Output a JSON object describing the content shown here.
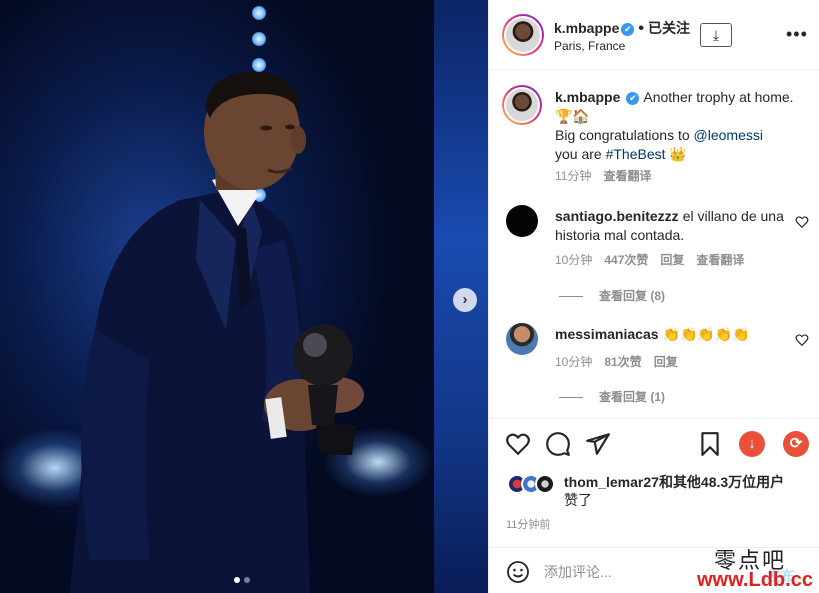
{
  "photo": {
    "carousel_next": "›",
    "slide_count": 2,
    "active_slide": 1
  },
  "header": {
    "username": "k.mbappe",
    "verified_mark": "✔",
    "separator": "•",
    "follow_state": "已关注",
    "location": "Paris, France",
    "download_icon": "⤓",
    "more_icon": "•••"
  },
  "caption": {
    "username": "k.mbappe",
    "text_1": "Another trophy at home. ",
    "emoji_1": "🏆🏠",
    "line_2": "Big congratulations to ",
    "mention": "@leomessi",
    "line_3": "you are ",
    "hashtag": "#TheBest",
    "emoji_2": "👑",
    "time": "11分钟",
    "see_translation": "查看翻译"
  },
  "comments": [
    {
      "username": "santiago.benitezzz",
      "text": "el villano de una historia mal contada.",
      "time": "10分钟",
      "likes": "447次赞",
      "reply": "回复",
      "see_translation": "查看翻译",
      "view_replies": "查看回复 (8)"
    },
    {
      "username": "messimaniacas",
      "text": "👏👏👏👏👏",
      "time": "10分钟",
      "likes": "81次赞",
      "reply": "回复",
      "view_replies": "查看回复 (1)"
    }
  ],
  "likes": {
    "names": "thom_lemar27",
    "and_others": "和",
    "others_bold": "其他48.3万位用户",
    "suffix": "赞了"
  },
  "post_time": "11分钟前",
  "add_comment": {
    "placeholder": "添加评论...",
    "post_label": "发布"
  },
  "watermark": {
    "chinese": "零点吧",
    "url": "www.Ldb.cc"
  },
  "colors": {
    "link": "#00376b",
    "verified": "#3897f0",
    "muted": "#8e8e8e",
    "download_red": "#e8503a"
  }
}
